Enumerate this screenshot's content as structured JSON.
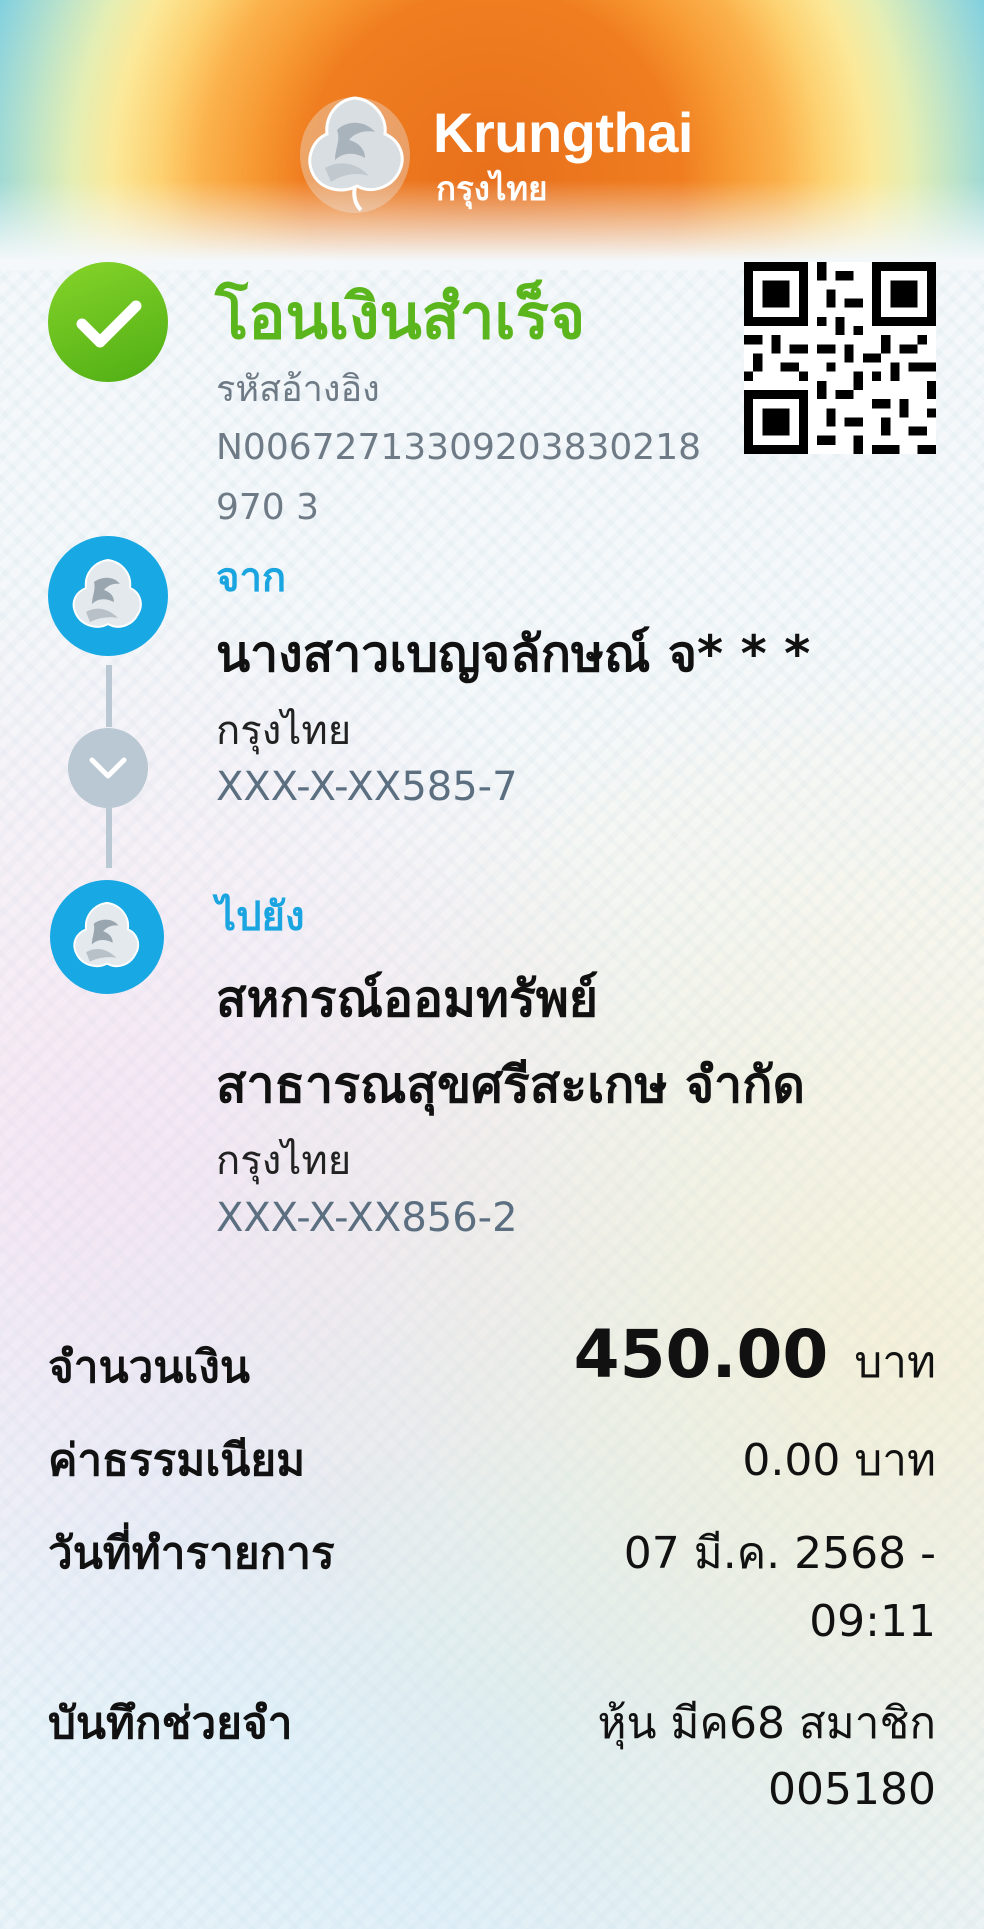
{
  "header": {
    "brand_en": "Krungthai",
    "brand_th": "กรุงไทย"
  },
  "status": {
    "title": "โอนเงินสำเร็จ",
    "ref_label": "รหัสอ้างอิง",
    "ref_value": "N00672713309203830218970 3"
  },
  "from": {
    "label": "จาก",
    "name": "นางสาวเบญจลักษณ์ จ* * *",
    "bank": "กรุงไทย",
    "account": "XXX-X-XX585-7"
  },
  "to": {
    "label": "ไปยัง",
    "name_line1": "สหกรณ์ออมทรัพย์",
    "name_line2": "สาธารณสุขศรีสะเกษ จำกัด",
    "bank": "กรุงไทย",
    "account": "XXX-X-XX856-2"
  },
  "details": {
    "amount_label": "จำนวนเงิน",
    "amount_value": "450.00",
    "amount_unit": "บาท",
    "fee_label": "ค่าธรรมเนียม",
    "fee_value": "0.00 บาท",
    "date_label": "วันที่ทำรายการ",
    "date_line1": "07 มี.ค. 2568 -",
    "date_line2": "09:11",
    "memo_label": "บันทึกช่วยจำ",
    "memo_line1": "หุ้น มีค68 สมาชิก",
    "memo_line2": "005180"
  },
  "colors": {
    "success_green": "#5bb61d",
    "accent_blue": "#1aa5e0"
  }
}
